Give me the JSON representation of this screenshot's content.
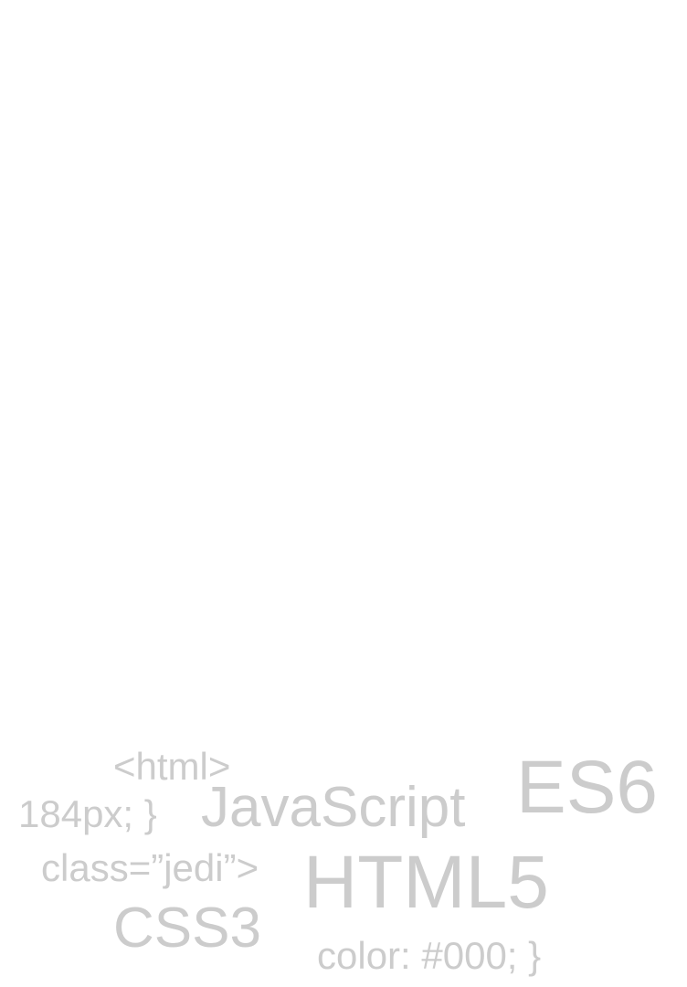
{
  "colors": {
    "background": "#ffffff",
    "word_text": "#cccccc"
  },
  "word_cloud": {
    "words": [
      {
        "text": "<html>"
      },
      {
        "text": "184px; }"
      },
      {
        "text": "JavaScript"
      },
      {
        "text": "ES6"
      },
      {
        "text": "class=”jedi”>"
      },
      {
        "text": "HTML5"
      },
      {
        "text": "CSS3"
      },
      {
        "text": "color: #000; }"
      }
    ]
  }
}
